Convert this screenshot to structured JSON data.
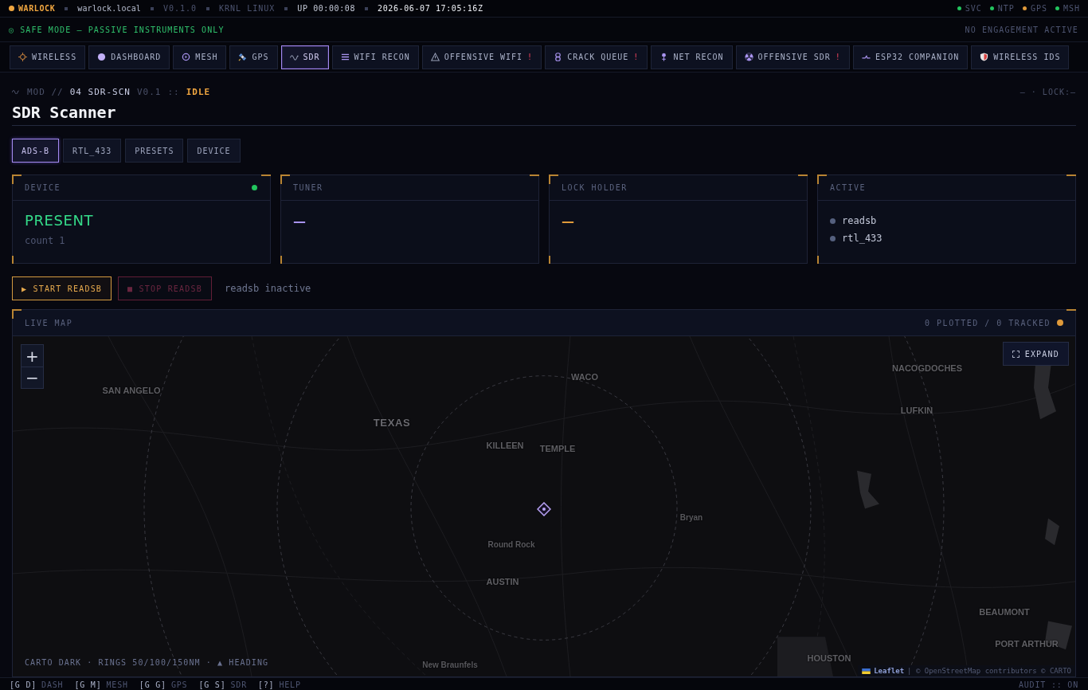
{
  "top_bar": {
    "brand": "WARLOCK",
    "host": "warlock.local",
    "version": "V0.1.0",
    "kernel": "KRNL LINUX",
    "uptime": "UP 00:00:08",
    "clock": "2026-06-07 17:05:16Z",
    "services": [
      {
        "label": "SVC",
        "color": "#22c55e"
      },
      {
        "label": "NTP",
        "color": "#22c55e"
      },
      {
        "label": "GPS",
        "color": "#e09a3a"
      },
      {
        "label": "MSH",
        "color": "#22c55e"
      }
    ]
  },
  "mode_bar": {
    "mode": "◎ SAFE MODE — PASSIVE INSTRUMENTS ONLY",
    "engagement": "NO ENGAGEMENT ACTIVE"
  },
  "nav_tabs": [
    {
      "label": "WIRELESS",
      "selected": false
    },
    {
      "label": "DASHBOARD",
      "selected": false
    },
    {
      "label": "MESH",
      "selected": false
    },
    {
      "label": "GPS",
      "selected": false
    },
    {
      "label": "SDR",
      "selected": true
    },
    {
      "label": "WIFI RECON",
      "selected": false
    },
    {
      "label": "OFFENSIVE WIFI",
      "selected": false,
      "badge": "!"
    },
    {
      "label": "CRACK QUEUE",
      "selected": false,
      "badge": "!"
    },
    {
      "label": "NET RECON",
      "selected": false
    },
    {
      "label": "OFFENSIVE SDR",
      "selected": false,
      "badge": "!"
    },
    {
      "label": "ESP32 COMPANION",
      "selected": false
    },
    {
      "label": "WIRELESS IDS",
      "selected": false
    }
  ],
  "module": {
    "prefix": "MOD //",
    "code": "04 SDR-SCN",
    "version": "V0.1",
    "separator": "::",
    "state": "IDLE",
    "lock": "— · LOCK:—",
    "title": "SDR Scanner"
  },
  "sub_tabs": [
    {
      "label": "ADS-B",
      "selected": true
    },
    {
      "label": "RTL_433",
      "selected": false
    },
    {
      "label": "PRESETS",
      "selected": false
    },
    {
      "label": "DEVICE",
      "selected": false
    }
  ],
  "cards": [
    {
      "title": "DEVICE",
      "kind": "status",
      "value": "PRESENT",
      "color": "#35dc8a",
      "detail": "count 1",
      "indicator": {
        "color": "#22c55e"
      }
    },
    {
      "title": "TUNER",
      "kind": "value",
      "value": "—",
      "color": "#a893ee"
    },
    {
      "title": "LOCK HOLDER",
      "kind": "value",
      "value": "—",
      "color": "#e09a3a"
    },
    {
      "title": "ACTIVE",
      "kind": "list",
      "items": [
        {
          "name": "readsb",
          "active": false
        },
        {
          "name": "rtl_433",
          "active": false
        }
      ]
    }
  ],
  "actions": {
    "buttons": [
      {
        "label": "▶ START READSB",
        "kind": "start",
        "disabled": false
      },
      {
        "label": "■ STOP READSB",
        "kind": "stop",
        "disabled": true
      }
    ],
    "status": "readsb inactive"
  },
  "live_map": {
    "title": "LIVE MAP",
    "counts": "0 PLOTTED / 0 TRACKED",
    "indicator": {
      "color": "#e09a3a"
    },
    "zoom_in": "+",
    "zoom_out": "−",
    "expand": "EXPAND",
    "labels": [
      {
        "text": "SAN ANGELO",
        "kind": "city"
      },
      {
        "text": "TEXAS",
        "kind": "state"
      },
      {
        "text": "WACO",
        "kind": "city"
      },
      {
        "text": "KILLEEN",
        "kind": "city"
      },
      {
        "text": "TEMPLE",
        "kind": "city"
      },
      {
        "text": "NACOGDOCHES",
        "kind": "city"
      },
      {
        "text": "LUFKIN",
        "kind": "city"
      },
      {
        "text": "Bryan",
        "kind": "town"
      },
      {
        "text": "Round Rock",
        "kind": "town"
      },
      {
        "text": "AUSTIN",
        "kind": "city"
      },
      {
        "text": "BEAUMONT",
        "kind": "city"
      },
      {
        "text": "PORT ARTHUR",
        "kind": "city"
      },
      {
        "text": "HOUSTON",
        "kind": "city"
      },
      {
        "text": "New Braunfels",
        "kind": "town"
      }
    ],
    "legend": "CARTO DARK · RINGS 50/100/150NM · ▲ HEADING",
    "attribution": {
      "link": "Leaflet",
      "text": "| © OpenStreetMap contributors © CARTO"
    }
  },
  "footer": {
    "shortcuts": [
      {
        "key": "[G D]",
        "label": "DASH"
      },
      {
        "key": "[G M]",
        "label": "MESH"
      },
      {
        "key": "[G G]",
        "label": "GPS"
      },
      {
        "key": "[G S]",
        "label": "SDR"
      },
      {
        "key": "[?]",
        "label": "HELP"
      }
    ],
    "audit": "AUDIT :: ON"
  }
}
